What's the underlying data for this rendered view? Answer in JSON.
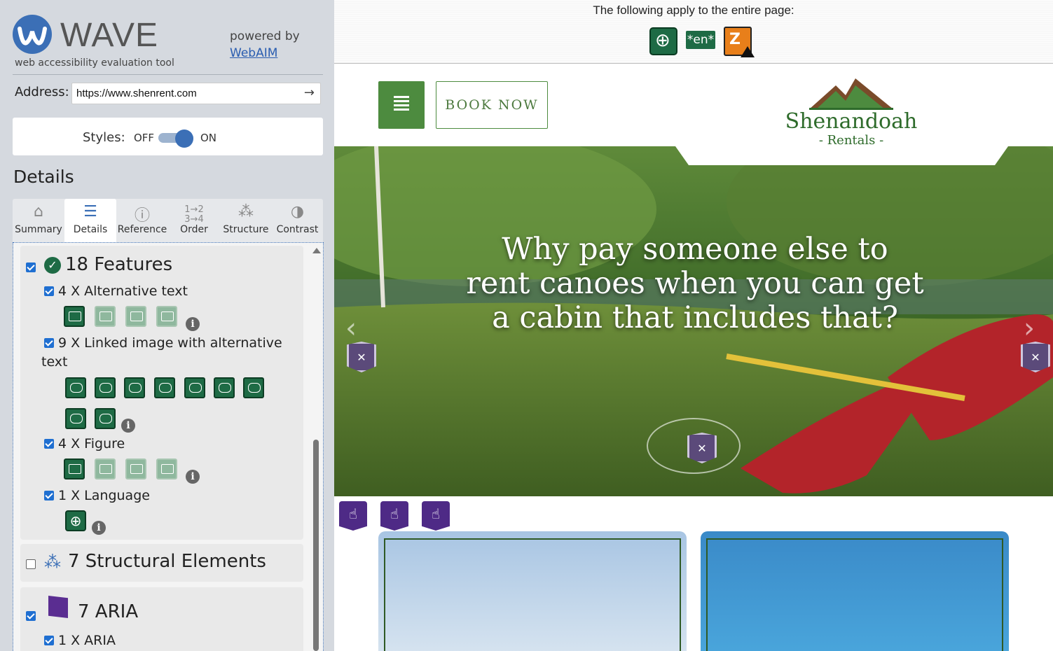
{
  "wave": {
    "title": "WAVE",
    "subtitle": "web accessibility evaluation tool",
    "powered_by": "powered by",
    "webaim_link": "WebAIM",
    "address_label": "Address:",
    "address_value": "https://www.shenrent.com",
    "styles_label": "Styles:",
    "styles_off": "OFF",
    "styles_on": "ON",
    "styles_state": "on",
    "details_heading": "Details",
    "brand_color": "#3b6fb6"
  },
  "tabs": [
    {
      "label": "Summary",
      "icon": "home-icon",
      "active": false
    },
    {
      "label": "Details",
      "icon": "list-icon",
      "active": true
    },
    {
      "label": "Reference",
      "icon": "info-icon",
      "active": false
    },
    {
      "label": "Order",
      "icon": "order-icon",
      "active": false
    },
    {
      "label": "Structure",
      "icon": "structure-icon",
      "active": false
    },
    {
      "label": "Contrast",
      "icon": "contrast-icon",
      "active": false
    }
  ],
  "categories": {
    "features": {
      "title": "18 Features",
      "checked": true,
      "icon": "check-circle-icon",
      "items": [
        {
          "label": "4 X Alternative text",
          "checked": true,
          "icons": 4
        },
        {
          "label_line1": "9 X Linked image with alternative",
          "label_line2": "text",
          "checked": true,
          "icons": 9
        },
        {
          "label": "4 X Figure",
          "checked": true,
          "icons": 4
        },
        {
          "label": "1 X Language",
          "checked": true,
          "icons": 1
        }
      ]
    },
    "structural": {
      "title": "7 Structural Elements",
      "checked": false,
      "icon": "structure-icon"
    },
    "aria": {
      "title": "7 ARIA",
      "checked": true,
      "icon": "aria-shield-icon",
      "items": [
        {
          "label": "1 X ARIA",
          "checked": true
        }
      ]
    }
  },
  "page": {
    "apply_text": "The following apply to the entire page:",
    "lang_badge": "*en*",
    "menu_icon": "hamburger-icon",
    "book_now": "BOOK NOW",
    "logo_name": "Shenandoah",
    "logo_sub": "- Rentals -",
    "hero_line1": "Why pay someone else to",
    "hero_line2": "rent canoes when you can get",
    "hero_line3": "a cabin that includes that?",
    "green": "#4d8b3f",
    "aria_purple": "#4e2a86"
  }
}
